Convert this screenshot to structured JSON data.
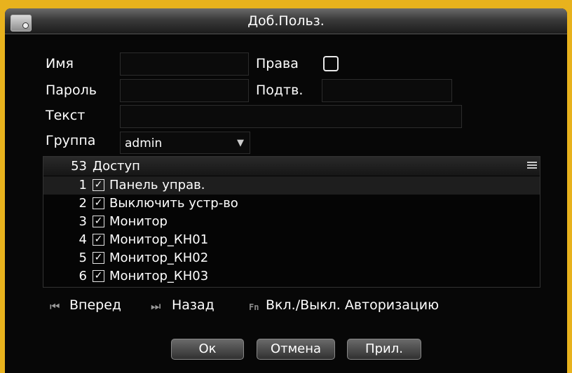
{
  "window": {
    "title": "Доб.Польз."
  },
  "form": {
    "name_label": "Имя",
    "rights_label": "Права",
    "password_label": "Пароль",
    "confirm_label": "Подтв.",
    "text_label": "Текст",
    "group_label": "Группа",
    "group_value": "admin"
  },
  "access_list": {
    "count": "53",
    "header": "Доступ",
    "rows": [
      {
        "num": "1",
        "label": "Панель управ.",
        "checked": true
      },
      {
        "num": "2",
        "label": "Выключить устр-во",
        "checked": true
      },
      {
        "num": "3",
        "label": "Монитор",
        "checked": true
      },
      {
        "num": "4",
        "label": "Монитор_КН01",
        "checked": true
      },
      {
        "num": "5",
        "label": "Монитор_КН02",
        "checked": true
      },
      {
        "num": "6",
        "label": "Монитор_КН03",
        "checked": true
      }
    ]
  },
  "nav": {
    "forward_label": "Вперед",
    "back_label": "Назад",
    "fn_icon": "Fn",
    "auth_label": "Вкл./Выкл. Авторизацию"
  },
  "buttons": {
    "ok": "Ок",
    "cancel": "Отмена",
    "apply": "Прил."
  },
  "colors": {
    "frame": "#e8b21d",
    "background": "#070707",
    "text": "#ffffff"
  }
}
